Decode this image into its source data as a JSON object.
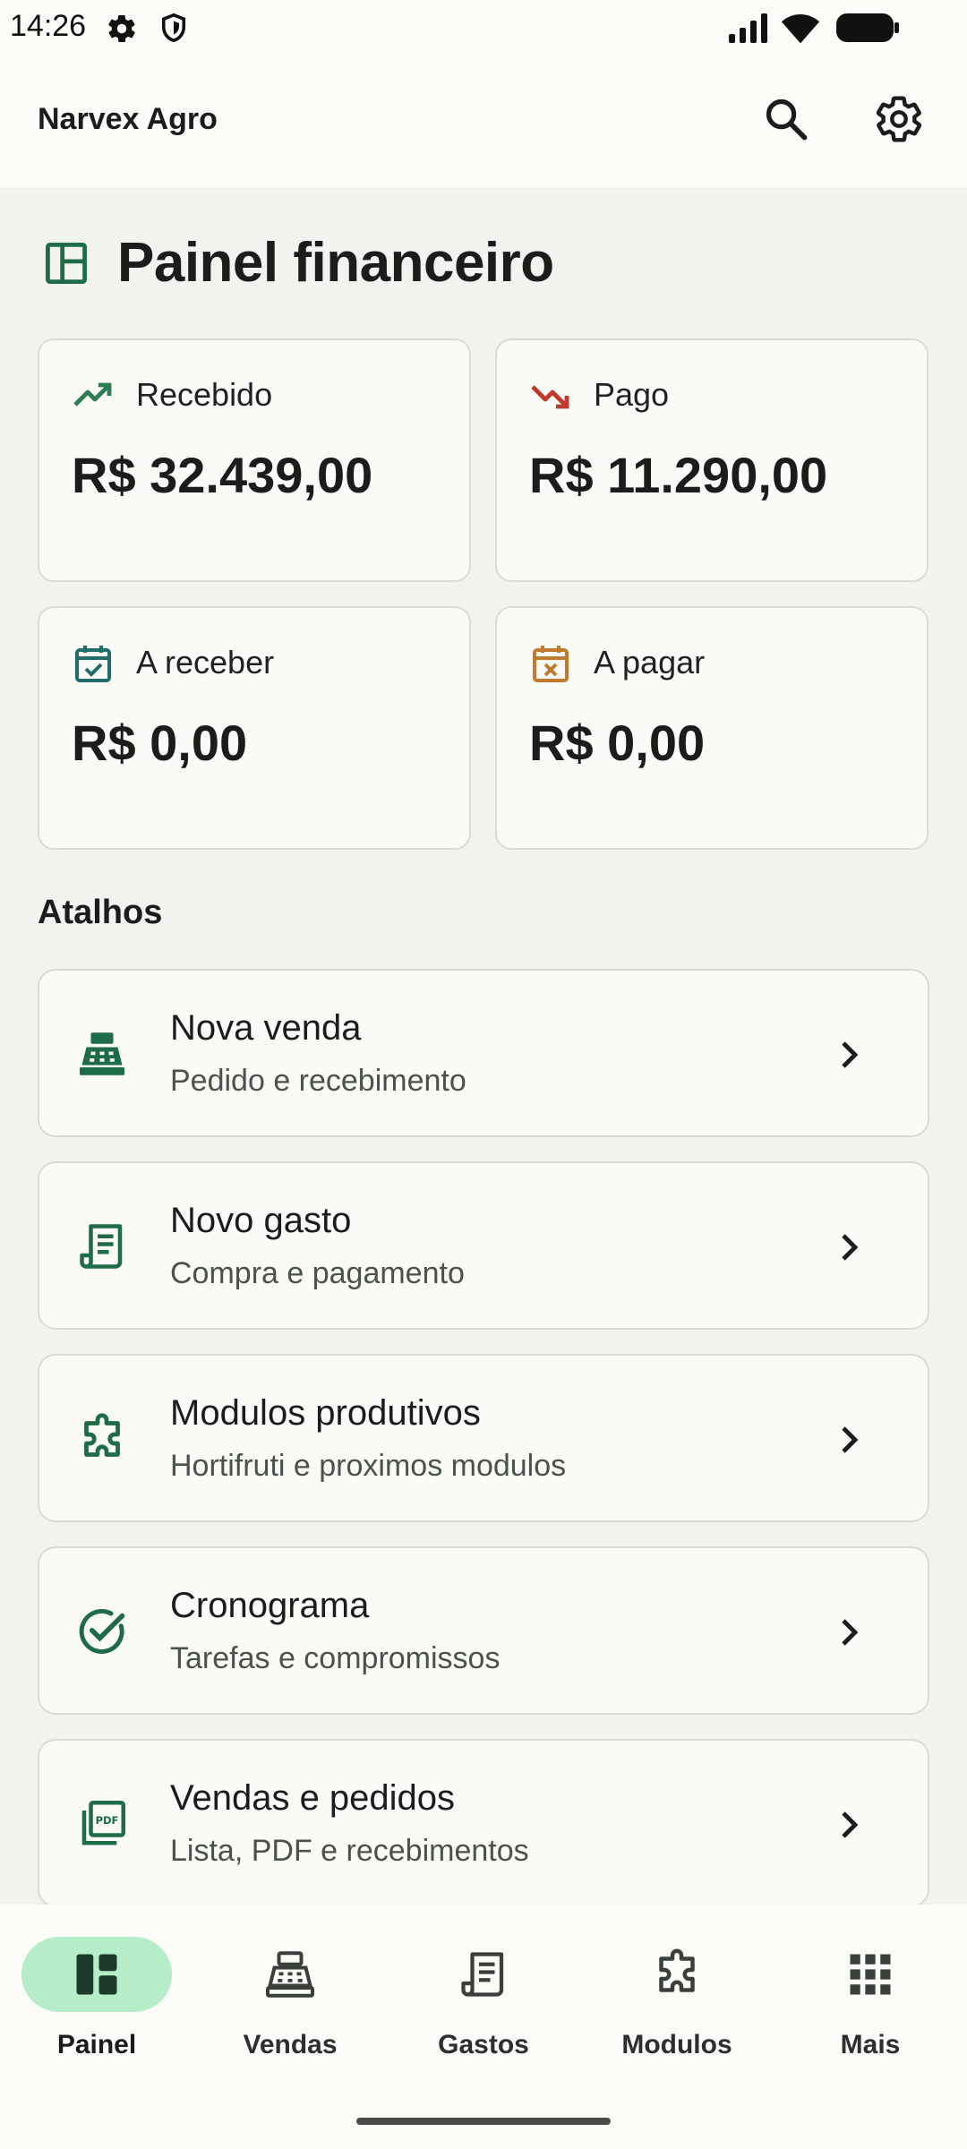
{
  "status_bar": {
    "time": "14:26",
    "icons": [
      "settings-gear-icon",
      "shield-icon",
      "signal-icon",
      "wifi-icon",
      "battery-icon"
    ]
  },
  "app_bar": {
    "title": "Narvex Agro",
    "search_icon": "search-icon",
    "settings_icon": "gear-icon"
  },
  "page": {
    "title": "Painel financeiro",
    "icon": "dashboard-icon"
  },
  "stats": [
    {
      "label": "Recebido",
      "value": "R$ 32.439,00",
      "icon": "trending-up-icon",
      "color": "#2e7d52"
    },
    {
      "label": "Pago",
      "value": "R$ 11.290,00",
      "icon": "trending-down-icon",
      "color": "#c0392b"
    },
    {
      "label": "A receber",
      "value": "R$ 0,00",
      "icon": "calendar-check-icon",
      "color": "#1f6e6a"
    },
    {
      "label": "A pagar",
      "value": "R$ 0,00",
      "icon": "calendar-x-icon",
      "color": "#c27a2c"
    }
  ],
  "shortcuts_section": {
    "title": "Atalhos",
    "items": [
      {
        "title": "Nova venda",
        "subtitle": "Pedido e recebimento",
        "icon": "cash-register-icon"
      },
      {
        "title": "Novo gasto",
        "subtitle": "Compra e pagamento",
        "icon": "receipt-icon"
      },
      {
        "title": "Modulos produtivos",
        "subtitle": "Hortifruti e proximos modulos",
        "icon": "puzzle-icon"
      },
      {
        "title": "Cronograma",
        "subtitle": "Tarefas e compromissos",
        "icon": "check-circle-icon"
      },
      {
        "title": "Vendas e pedidos",
        "subtitle": "Lista, PDF e recebimentos",
        "icon": "pdf-icon"
      }
    ]
  },
  "bottom_nav": {
    "items": [
      {
        "label": "Painel",
        "icon": "dashboard-icon",
        "active": true
      },
      {
        "label": "Vendas",
        "icon": "cash-register-icon",
        "active": false
      },
      {
        "label": "Gastos",
        "icon": "receipt-icon",
        "active": false
      },
      {
        "label": "Modulos",
        "icon": "puzzle-icon",
        "active": false
      },
      {
        "label": "Mais",
        "icon": "apps-grid-icon",
        "active": false
      }
    ]
  },
  "colors": {
    "accent_green": "#1e6b47",
    "active_pill": "#b7ecc8",
    "background": "#f2f3ef",
    "card_border": "#d9dcd5"
  }
}
